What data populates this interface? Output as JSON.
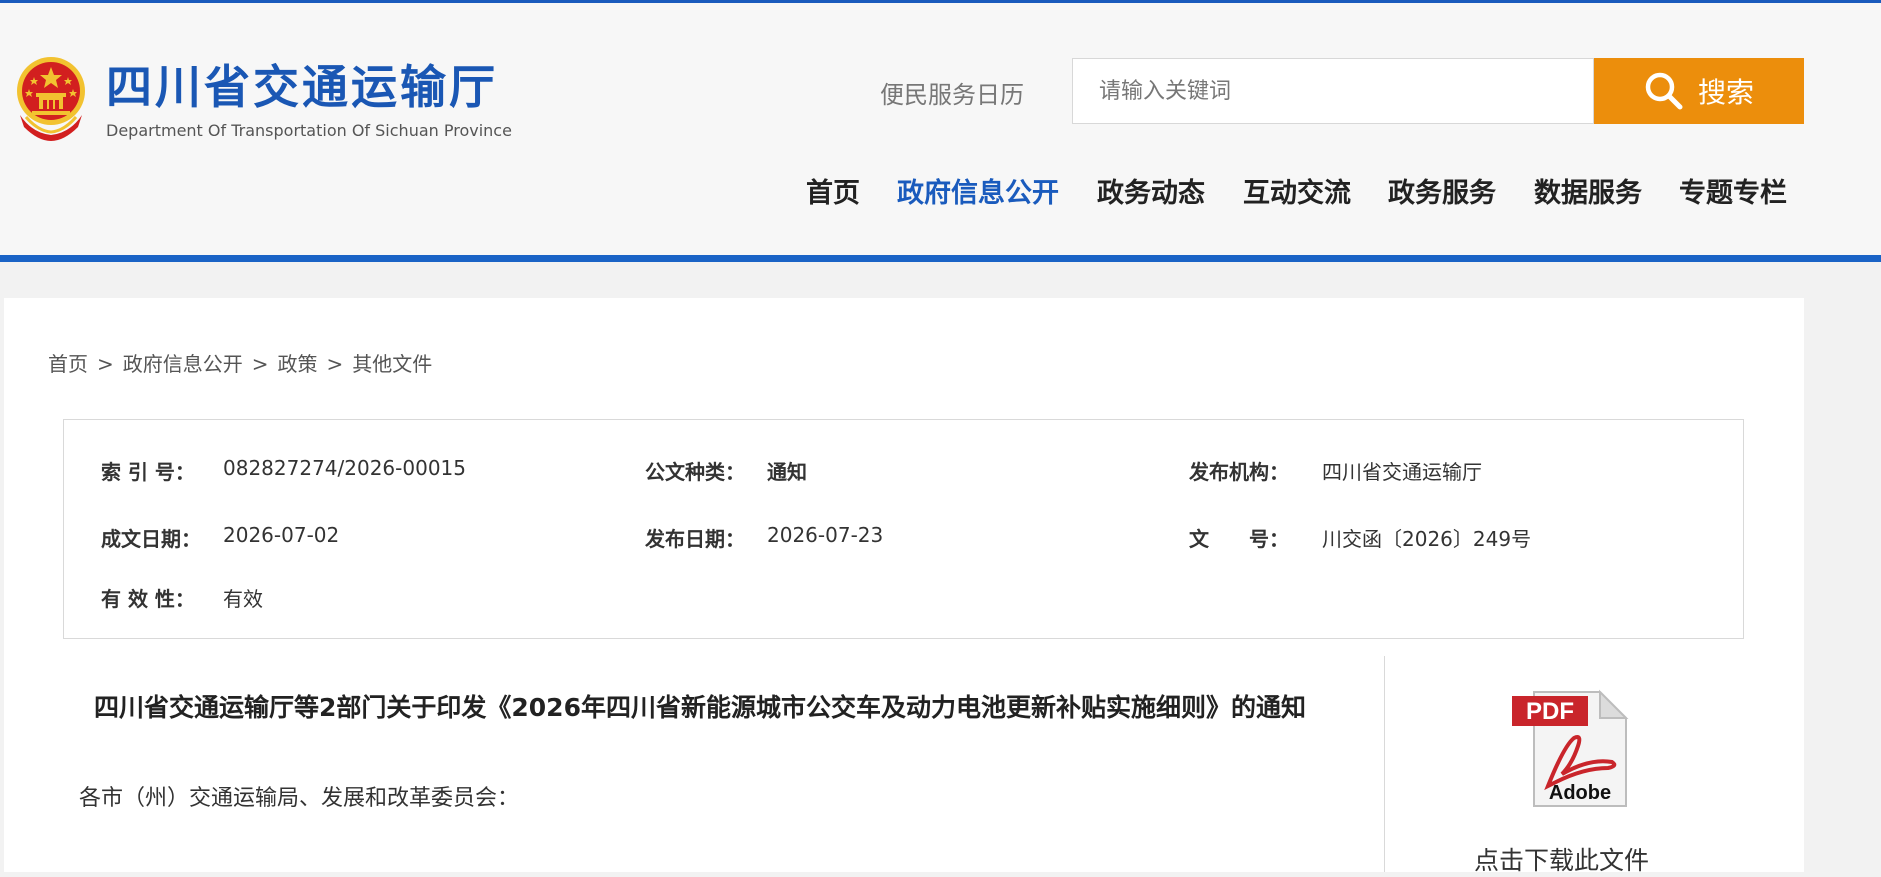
{
  "header": {
    "logo_cn": "四川省交通运输厅",
    "logo_en": "Department Of Transportation Of Sichuan Province",
    "calendar_link": "便民服务日历",
    "search_placeholder": "请输入关键词",
    "search_button": "搜索"
  },
  "nav": {
    "items": [
      {
        "label": "首页"
      },
      {
        "label": "政府信息公开",
        "active": true
      },
      {
        "label": "政务动态"
      },
      {
        "label": "互动交流"
      },
      {
        "label": "政务服务"
      },
      {
        "label": "数据服务"
      },
      {
        "label": "专题专栏"
      }
    ]
  },
  "breadcrumb": {
    "items": [
      "首页",
      "政府信息公开",
      "政策",
      "其他文件"
    ],
    "separator": ">"
  },
  "meta": {
    "index_label": "索 引 号：",
    "index_value": "082827274/2026-00015",
    "type_label": "公文种类：",
    "type_value": "通知",
    "publisher_label": "发布机构：",
    "publisher_value": "四川省交通运输厅",
    "written_date_label": "成文日期：",
    "written_date_value": "2026-07-02",
    "publish_date_label": "发布日期：",
    "publish_date_value": "2026-07-23",
    "doc_no_label": "文　　号：",
    "doc_no_value": "川交函〔2026〕249号",
    "validity_label": "有 效 性：",
    "validity_value": "有效"
  },
  "document": {
    "title": "四川省交通运输厅等2部门关于印发《2026年四川省新能源城市公交车及动力电池更新补贴实施细则》的通知",
    "salutation": "各市（州）交通运输局、发展和改革委员会："
  },
  "sidebar": {
    "pdf_label": "PDF",
    "adobe_label": "Adobe",
    "download_label": "点击下载此文件"
  },
  "colors": {
    "brand_blue": "#1a5bbd",
    "search_orange": "#ec8e0c",
    "emblem_red": "#d21f1f",
    "emblem_gold": "#f2c230"
  }
}
